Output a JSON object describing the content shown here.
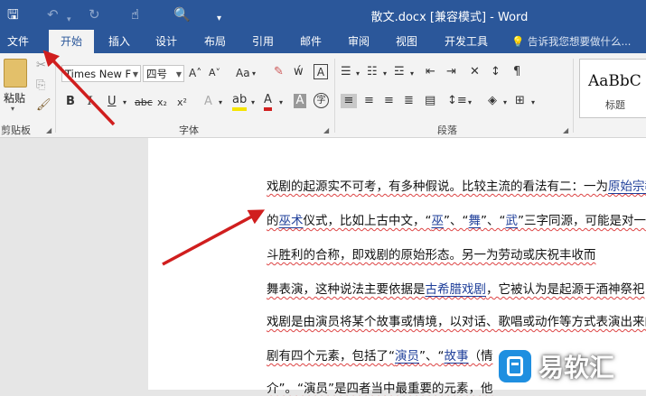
{
  "window": {
    "title": "散文.docx [兼容模式] - Word"
  },
  "quick_access": {
    "save": "🖫",
    "undo": "↶",
    "redo": "↻",
    "touch": "☝",
    "preview": "🔍",
    "more": "▾"
  },
  "tabs": [
    {
      "label": "文件"
    },
    {
      "label": "开始"
    },
    {
      "label": "插入"
    },
    {
      "label": "设计"
    },
    {
      "label": "布局"
    },
    {
      "label": "引用"
    },
    {
      "label": "邮件"
    },
    {
      "label": "审阅"
    },
    {
      "label": "视图"
    },
    {
      "label": "开发工具"
    }
  ],
  "tell_me": "告诉我您想要做什么...",
  "clipboard": {
    "paste": "粘贴",
    "label": "剪贴板"
  },
  "font": {
    "family": "Times New F",
    "size": "四号",
    "label": "字体",
    "grow": "A˄",
    "shrink": "A˅",
    "case": "Aa",
    "clear": "✎",
    "phonetic": "ẃ",
    "border_char": "A"
  },
  "paragraph": {
    "label": "段落"
  },
  "styles": {
    "sample": "AaBbC",
    "name": "标题"
  },
  "document": {
    "lines": [
      [
        {
          "t": "戏剧的起源实不可考，有多种假说。比较主流的看法有二：一为"
        },
        {
          "t": "原始宗教",
          "link": true
        }
      ],
      [
        {
          "t": "的"
        },
        {
          "t": "巫术",
          "link": true
        },
        {
          "t": "仪式，比如上古中文，“"
        },
        {
          "t": "巫",
          "link": true
        },
        {
          "t": "”、“"
        },
        {
          "t": "舞",
          "link": true
        },
        {
          "t": "”、“"
        },
        {
          "t": "武",
          "link": true
        },
        {
          "t": "”三字同源，可能是对一种"
        }
      ],
      [
        {
          "t": "斗胜利的合称，即戏剧的原始形态。另一为劳动或庆祝丰收而"
        }
      ],
      [
        {
          "t": "舞表演，这种说法主要依据是"
        },
        {
          "t": "古希腊戏剧",
          "link": true
        },
        {
          "t": "，它被认为是起源于酒神祭祀"
        }
      ],
      [
        {
          "t": "戏剧是由演员将某个故事或情境，以对话、歌唱或动作等方式表演出来的"
        }
      ],
      [
        {
          "t": "剧有四个元素，包括了“"
        },
        {
          "t": "演员",
          "link": true
        },
        {
          "t": "”、“"
        },
        {
          "t": "故事",
          "link": true
        },
        {
          "t": "（情"
        }
      ],
      [
        {
          "t": "介”。“演员”是四者当中最重要的元素，他"
        }
      ]
    ]
  },
  "watermark": {
    "text": "易软汇"
  }
}
